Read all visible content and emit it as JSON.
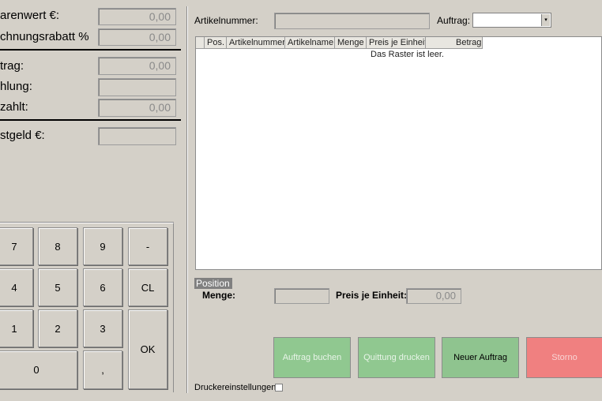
{
  "left": {
    "warenwert_label": "arenwert €:",
    "warenwert_value": "0,00",
    "rabatt_label": "chnungsrabatt %",
    "rabatt_value": "0,00",
    "betrag_label": "trag:",
    "betrag_value": "0,00",
    "zahlung_label": "hlung:",
    "bezahlt_label": "zahlt:",
    "bezahlt_value": "0,00",
    "rueckgeld_label": "stgeld €:"
  },
  "keypad": {
    "k7": "7",
    "k8": "8",
    "k9": "9",
    "kminus": "-",
    "k4": "4",
    "k5": "5",
    "k6": "6",
    "kcl": "CL",
    "k1": "1",
    "k2": "2",
    "k3": "3",
    "kok": "OK",
    "k0": "0",
    "kcomma": ","
  },
  "top": {
    "artikelnummer_label": "Artikelnummer:",
    "auftrag_label": "Auftrag:"
  },
  "grid": {
    "columns": [
      "Pos.",
      "Artikelnummer",
      "Artikelname",
      "Menge",
      "Preis je Einheit",
      "Betrag"
    ],
    "empty_text": "Das Raster ist leer."
  },
  "position": {
    "header": "Position",
    "menge_label": "Menge:",
    "preis_label": "Preis je Einheit:",
    "preis_value": "0,00"
  },
  "buttons": {
    "auftrag_buchen": "Auftrag buchen",
    "quittung_drucken": "Quittung drucken",
    "neuer_auftrag": "Neuer Auftrag",
    "storno": "Storno"
  },
  "footer": {
    "drucker_label": "Druckereinstellungen:"
  },
  "colors": {
    "green": "#90c890",
    "green_active": "#8fc48f",
    "red": "#f08080",
    "panel": "#d4d0c8"
  }
}
